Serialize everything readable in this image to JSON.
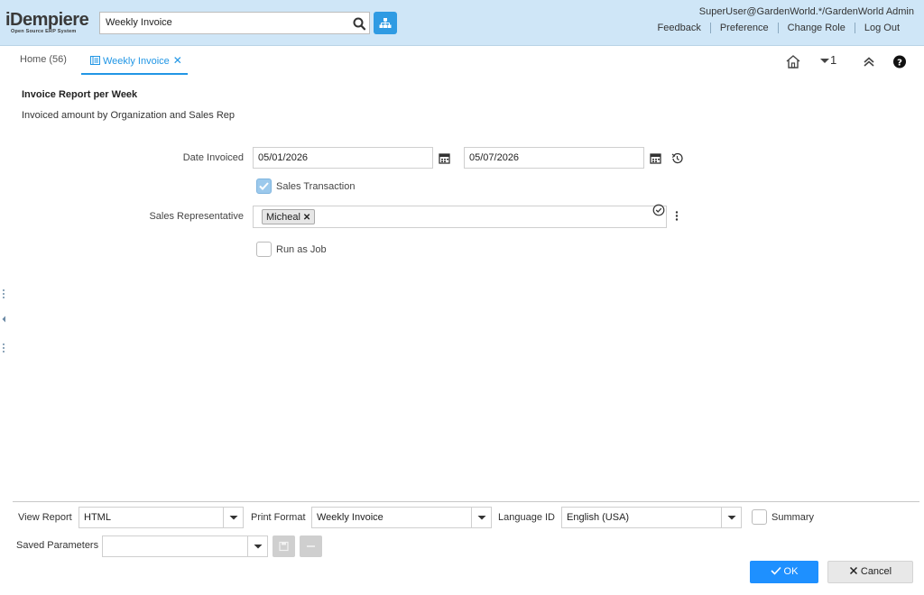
{
  "header": {
    "logo_main": "iDempiere",
    "logo_sub": "Open Source ERP System",
    "search_value": "Weekly Invoice",
    "user": "SuperUser@GardenWorld.*/GardenWorld Admin",
    "links": [
      "Feedback",
      "Preference",
      "Change Role",
      "Log Out"
    ]
  },
  "tabs": {
    "home": "Home (56)",
    "active": "Weekly Invoice",
    "window_count": "1"
  },
  "report": {
    "title": "Invoice Report per Week",
    "description": "Invoiced amount by Organization and Sales Rep"
  },
  "params": {
    "date_label": "Date Invoiced",
    "date_from": "05/01/2026",
    "date_to": "05/07/2026",
    "sales_tx_label": "Sales Transaction",
    "sales_tx_checked": true,
    "sales_rep_label": "Sales Representative",
    "sales_rep_tag": "Micheal",
    "run_job_label": "Run as Job",
    "run_job_checked": false
  },
  "footer": {
    "view_report_label": "View Report",
    "view_report_value": "HTML",
    "print_format_label": "Print Format",
    "print_format_value": "Weekly Invoice",
    "language_label": "Language ID",
    "language_value": "English (USA)",
    "summary_label": "Summary",
    "saved_params_label": "Saved Parameters",
    "saved_params_value": "",
    "ok_label": "OK",
    "cancel_label": "Cancel"
  },
  "colors": {
    "header_bg": "#cfe6f7",
    "accent": "#2196e5",
    "ok_button": "#1e90ff"
  }
}
